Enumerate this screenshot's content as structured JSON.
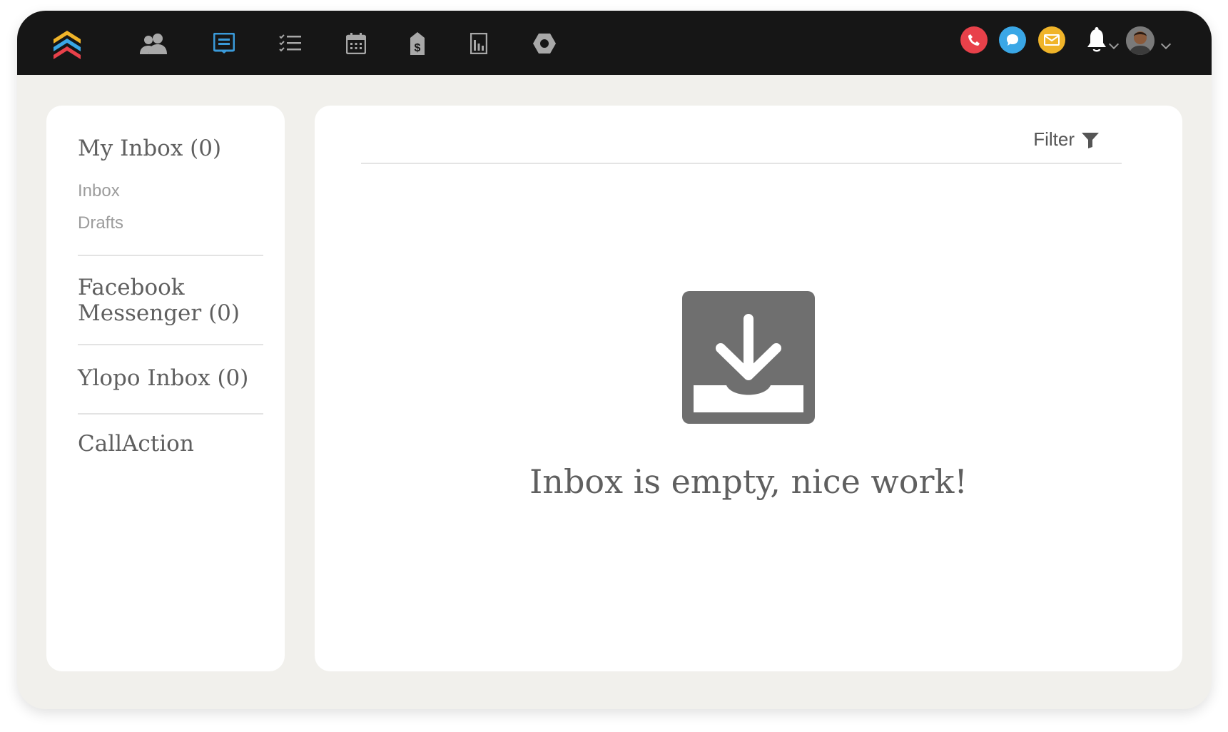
{
  "topbar": {
    "nav_icons": [
      "logo-icon",
      "people-icon",
      "inbox-icon",
      "tasks-icon",
      "calendar-icon",
      "deals-icon",
      "reports-icon",
      "admin-icon"
    ],
    "active_nav": "inbox-icon",
    "action_buttons": [
      {
        "name": "phone-icon",
        "color": "#e8414a"
      },
      {
        "name": "chat-icon",
        "color": "#3aa7e6"
      },
      {
        "name": "mail-icon",
        "color": "#f0b429"
      }
    ],
    "accent_color": "#3a9ad9"
  },
  "sidebar": {
    "sections": [
      {
        "title": "My Inbox (0)",
        "items": [
          "Inbox",
          "Drafts"
        ]
      },
      {
        "title": "Facebook Messenger (0)"
      },
      {
        "title": "Ylopo Inbox (0)"
      },
      {
        "title": "CallAction"
      }
    ],
    "facebook_line1": "Facebook",
    "facebook_line2": "Messenger (0)"
  },
  "main": {
    "filter_label": "Filter",
    "empty_icon": "inbox-download-icon",
    "empty_message": "Inbox is empty, nice work!"
  }
}
